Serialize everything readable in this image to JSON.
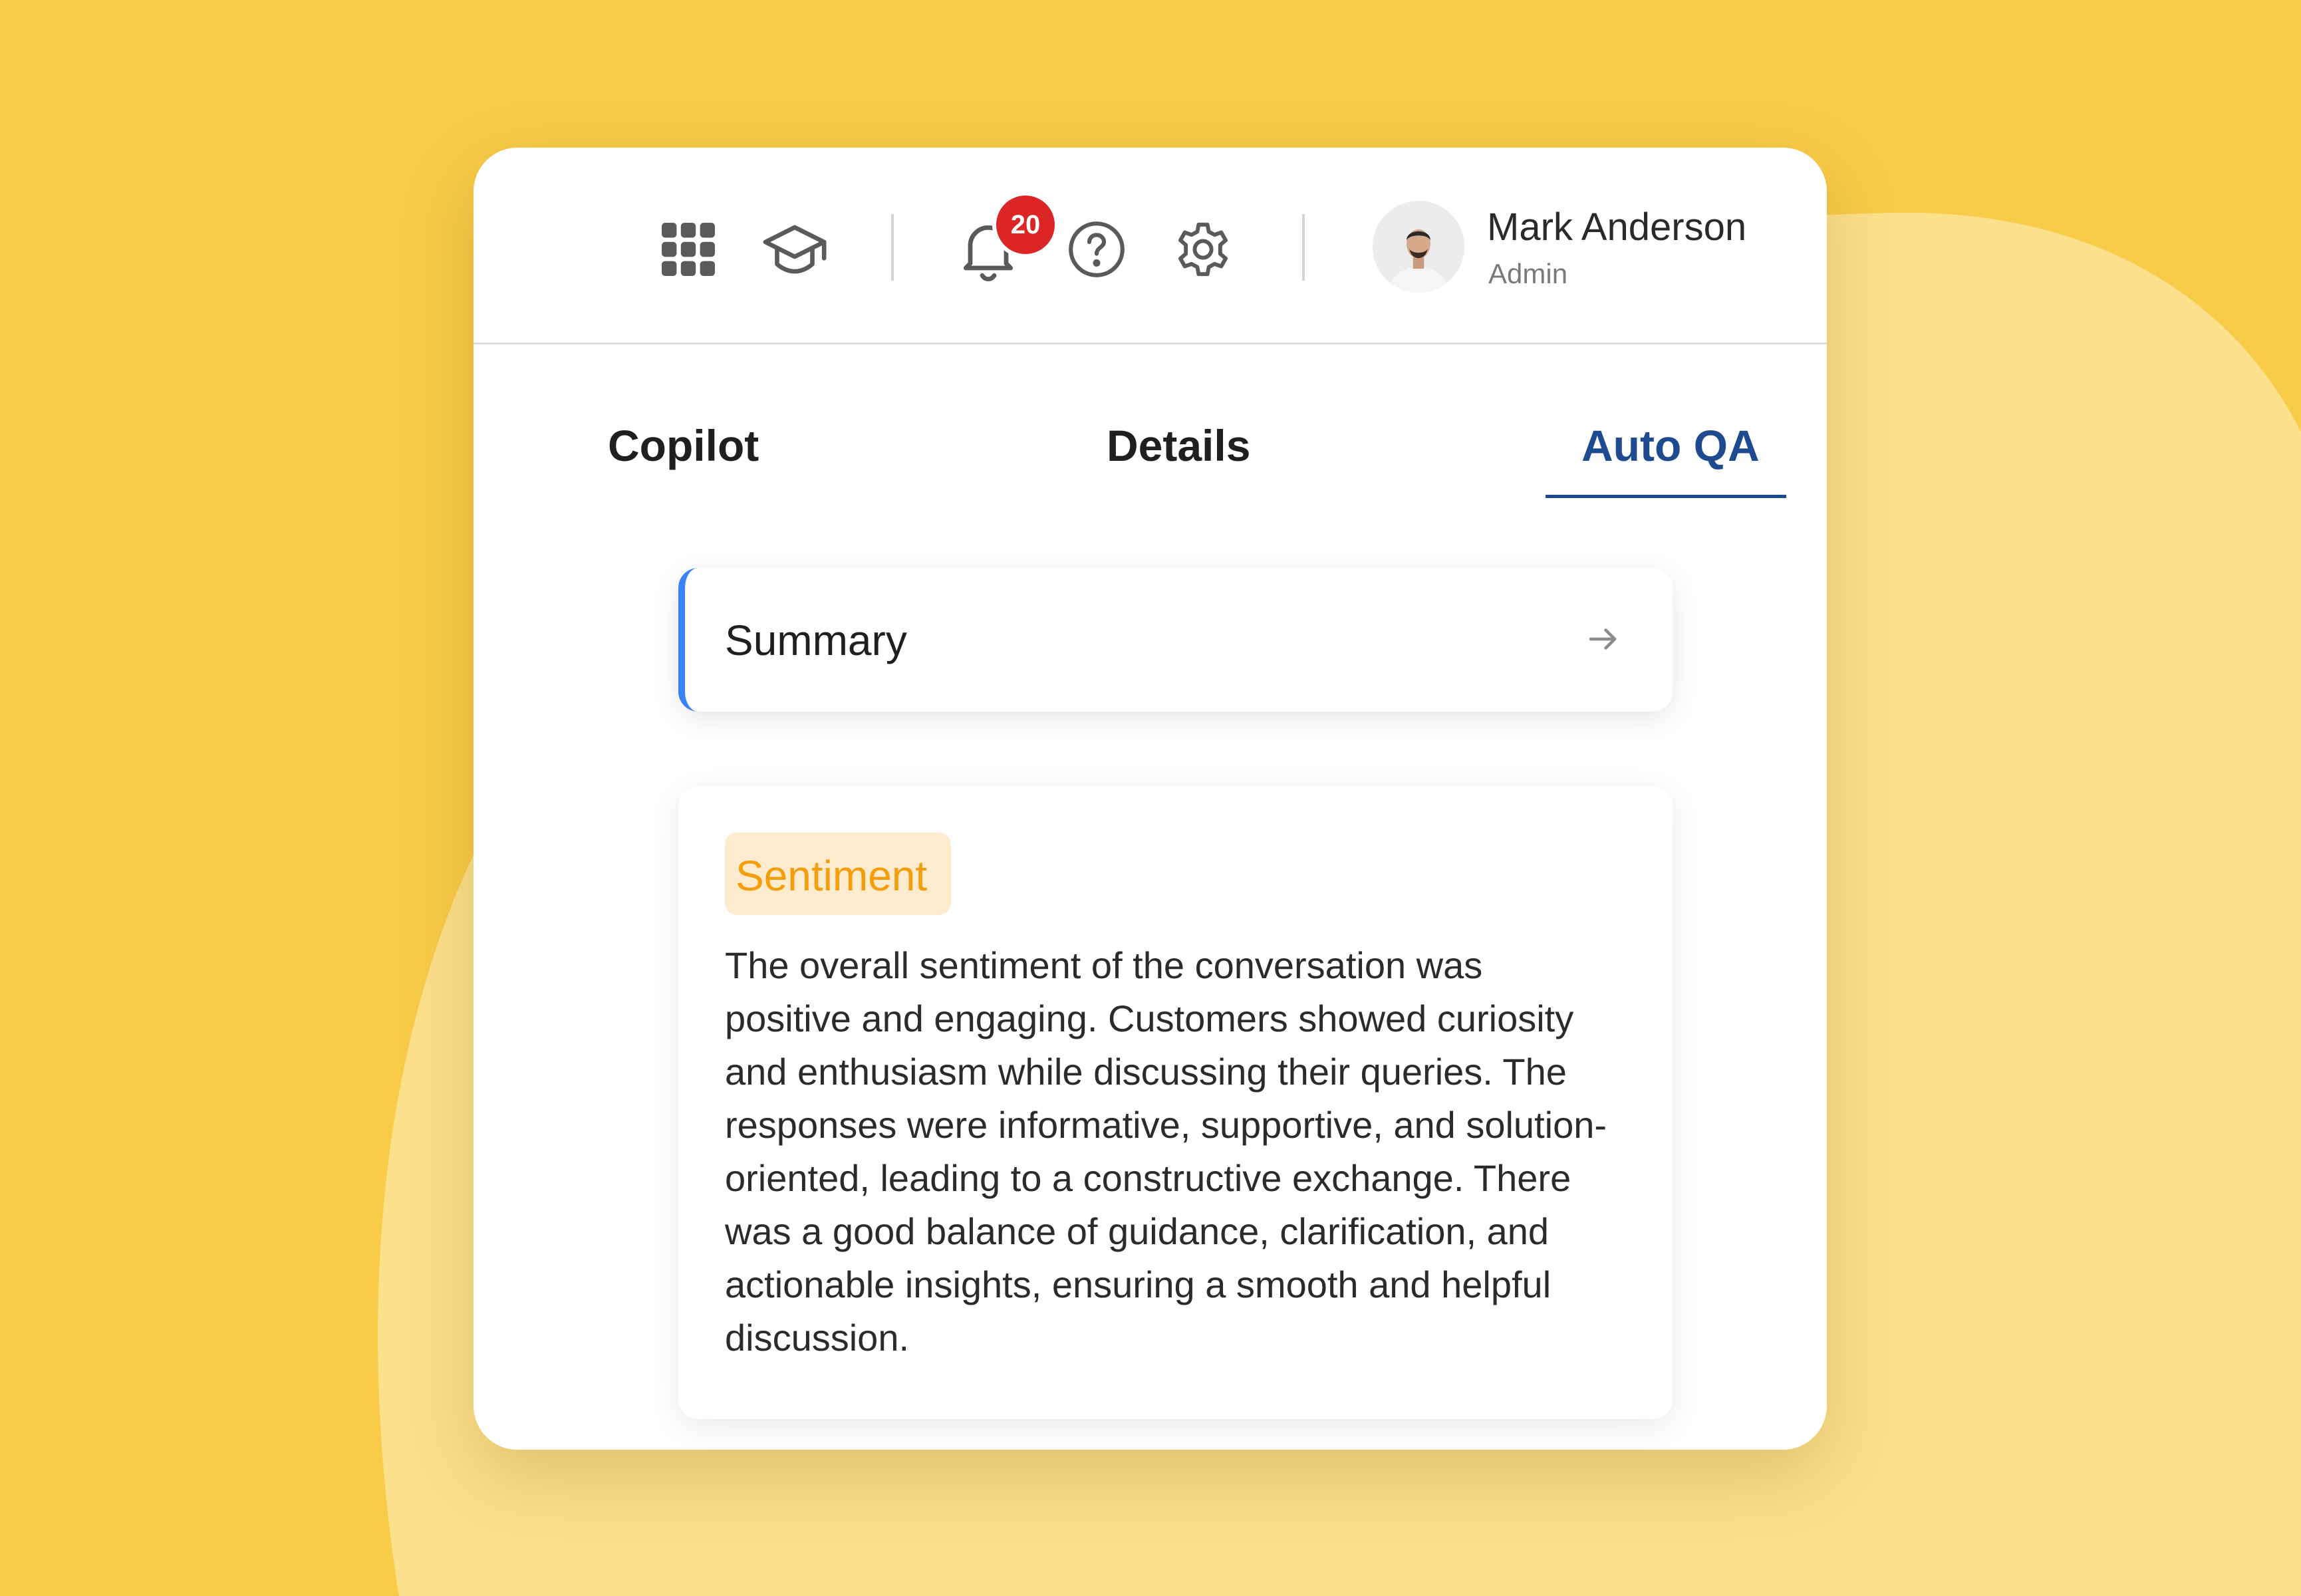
{
  "colors": {
    "background": "#F8CB48",
    "blob": "#FDE08C",
    "accent_blue": "#1E4B8F",
    "summary_border": "#3B82F6",
    "badge": "#DC2626",
    "sentiment_text": "#F59E0B",
    "sentiment_chip": "#FDEBCD"
  },
  "header": {
    "icons": [
      "apps-grid-icon",
      "graduation-cap-icon",
      "bell-icon",
      "help-circle-icon",
      "gear-icon"
    ],
    "notification_count": "20",
    "user": {
      "name": "Mark Anderson",
      "role": "Admin"
    }
  },
  "tabs": [
    {
      "label": "Copilot",
      "active": false
    },
    {
      "label": "Details",
      "active": false
    },
    {
      "label": "Auto QA",
      "active": true
    }
  ],
  "summary": {
    "label": "Summary",
    "icon": "arrow-right-icon"
  },
  "sentiment": {
    "label": "Sentiment",
    "lines": [
      "The overall sentiment of the conversation was",
      "positive and engaging. Customers showed curiosity",
      "and enthusiasm while discussing their queries. The",
      "responses were informative, supportive, and solution-",
      "oriented, leading to a constructive exchange. There",
      "was a good balance of guidance, clarification, and",
      "actionable insights, ensuring a smooth and helpful",
      "discussion."
    ]
  }
}
